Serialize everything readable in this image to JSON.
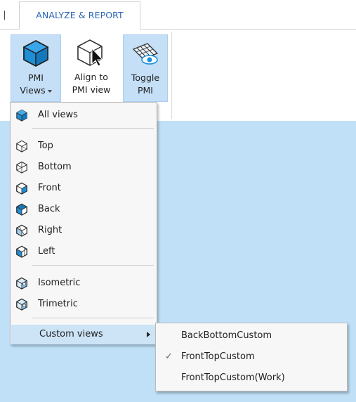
{
  "tab": {
    "label": "ANALYZE & REPORT"
  },
  "ribbon": {
    "buttons": [
      {
        "label_line1": "PMI",
        "label_line2": "Views",
        "icon": "cube-solid-icon",
        "active": true,
        "has_dropdown": true
      },
      {
        "label_line1": "Align to",
        "label_line2": "PMI view",
        "icon": "cube-cursor-icon",
        "active": false
      },
      {
        "label_line1": "Toggle",
        "label_line2": "PMI",
        "icon": "pmi-grid-eye-icon",
        "active": true
      }
    ]
  },
  "menu": {
    "items": [
      {
        "label": "All views",
        "icon": "cube-solid-icon"
      },
      {
        "label": "Top",
        "icon": "cube-top-icon"
      },
      {
        "label": "Bottom",
        "icon": "cube-bottom-icon"
      },
      {
        "label": "Front",
        "icon": "cube-front-icon"
      },
      {
        "label": "Back",
        "icon": "cube-back-icon"
      },
      {
        "label": "Right",
        "icon": "cube-right-icon"
      },
      {
        "label": "Left",
        "icon": "cube-left-icon"
      },
      {
        "label": "Isometric",
        "icon": "cube-isometric-icon"
      },
      {
        "label": "Trimetric",
        "icon": "cube-trimetric-icon"
      },
      {
        "label": "Custom views",
        "has_submenu": true
      }
    ]
  },
  "submenu": {
    "items": [
      {
        "label": "BackBottomCustom",
        "checked": false
      },
      {
        "label": "FrontTopCustom",
        "checked": true,
        "check_glyph": "✓"
      },
      {
        "label": "FrontTopCustom(Work)",
        "checked": false
      }
    ]
  },
  "colors": {
    "accent": "#2b64b4",
    "active_bg": "#c4dff6",
    "viewport_bg": "#bfe0f7",
    "icon_blue": "#1c8fd6"
  }
}
